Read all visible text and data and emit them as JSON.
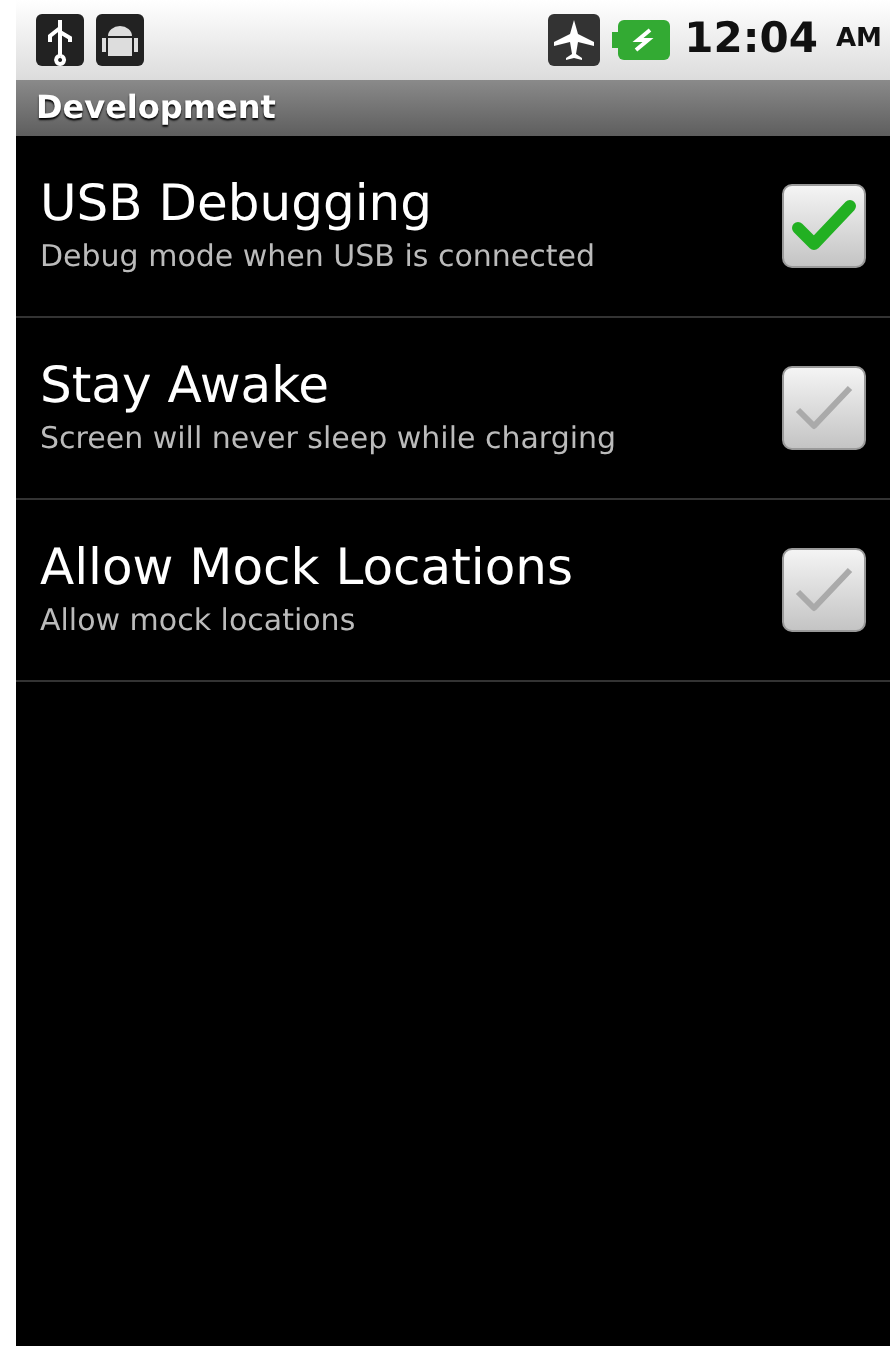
{
  "status_bar": {
    "time": "12:04",
    "meridiem": "AM"
  },
  "title_bar": {
    "title": "Development"
  },
  "settings": [
    {
      "title": "USB Debugging",
      "summary": "Debug mode when USB is connected",
      "checked": true
    },
    {
      "title": "Stay Awake",
      "summary": "Screen will never sleep while charging",
      "checked": false
    },
    {
      "title": "Allow Mock Locations",
      "summary": "Allow mock locations",
      "checked": false
    }
  ]
}
